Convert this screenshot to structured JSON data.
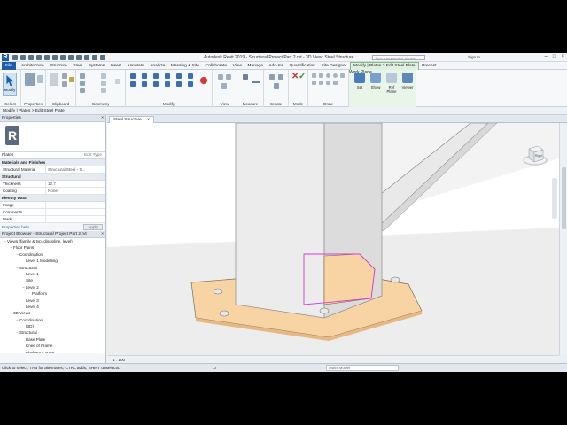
{
  "window": {
    "title": "Autodesk Revit 2019 - Structural Project Part 2.rvt - 3D View: Steel Structure",
    "search_placeholder": "Type a keyword or phrase",
    "sign_in": "Sign In"
  },
  "tabs": [
    "File",
    "Architecture",
    "Structure",
    "Steel",
    "Systems",
    "Insert",
    "Annotate",
    "Analyze",
    "Massing & Site",
    "Collaborate",
    "View",
    "Manage",
    "Add-Ins",
    "Quantification",
    "Site Designer",
    "Modify | Plates > Edit Steel Plate",
    "Precast"
  ],
  "ribbon_groups": {
    "select": "Select",
    "properties": "Properties",
    "clipboard": "Clipboard",
    "geometry": "Geometry",
    "modify": "Modify",
    "view": "View",
    "measure": "Measure",
    "create": "Create",
    "mode": "Mode",
    "draw": "Draw",
    "workplane": "Work Plane"
  },
  "ribbon_buttons": {
    "modify": "Modify",
    "set": "Set",
    "show": "Show",
    "ref_plane": "Ref Plane",
    "viewer": "Viewer"
  },
  "options_bar": "Modify | Plates > Edit Steel Plate",
  "properties_panel": {
    "title": "Properties",
    "type": "Plates",
    "edit_type": "Edit Type",
    "sections": [
      {
        "name": "Materials and Finishes",
        "rows": [
          {
            "k": "Structural Material",
            "v": "Structural Steel - S..."
          }
        ]
      },
      {
        "name": "Structural",
        "rows": [
          {
            "k": "Thickness",
            "v": "12.7"
          },
          {
            "k": "Coating",
            "v": "None"
          }
        ]
      },
      {
        "name": "Identity Data",
        "rows": [
          {
            "k": "Image",
            "v": ""
          },
          {
            "k": "Comments",
            "v": ""
          },
          {
            "k": "Mark",
            "v": ""
          }
        ]
      }
    ],
    "help_link": "Properties help",
    "apply": "Apply"
  },
  "project_browser": {
    "title": "Project Browser - Structural Project Part 2.rvt",
    "nodes": [
      {
        "t": "Views (family & typ, discipline, level)",
        "d": 0,
        "e": "−"
      },
      {
        "t": "Floor Plans",
        "d": 1,
        "e": "−"
      },
      {
        "t": "Coordination",
        "d": 2,
        "e": "−"
      },
      {
        "t": "Level 1 Modelling",
        "d": 3,
        "e": ""
      },
      {
        "t": "Structural",
        "d": 2,
        "e": "−"
      },
      {
        "t": "Level 1",
        "d": 3,
        "e": ""
      },
      {
        "t": "Site",
        "d": 3,
        "e": ""
      },
      {
        "t": "Level 2",
        "d": 3,
        "e": "−"
      },
      {
        "t": "Platform",
        "d": 4,
        "e": ""
      },
      {
        "t": "Level 3",
        "d": 3,
        "e": ""
      },
      {
        "t": "Level 4",
        "d": 3,
        "e": ""
      },
      {
        "t": "3D Views",
        "d": 1,
        "e": "−"
      },
      {
        "t": "Coordination",
        "d": 2,
        "e": "−"
      },
      {
        "t": "{3D}",
        "d": 3,
        "e": ""
      },
      {
        "t": "Structural",
        "d": 2,
        "e": "−"
      },
      {
        "t": "Base Plate",
        "d": 3,
        "e": ""
      },
      {
        "t": "Knee of Frame",
        "d": 3,
        "e": ""
      },
      {
        "t": "Platform Corner",
        "d": 3,
        "e": ""
      }
    ]
  },
  "view_tab": "Steel Structure",
  "view_cube": "Right",
  "view_scale": "1 : 100",
  "status": {
    "text": "Click to select, TAB for alternates, CTRL adds, SHIFT unselects.",
    "zero": ":0",
    "model": "Main Model"
  },
  "colors": {
    "accent": "#1e5ea8",
    "plate_fill": "#f8d3a4",
    "sketch_line": "#d23fcf",
    "contextual_tab": "#dff0e0"
  }
}
